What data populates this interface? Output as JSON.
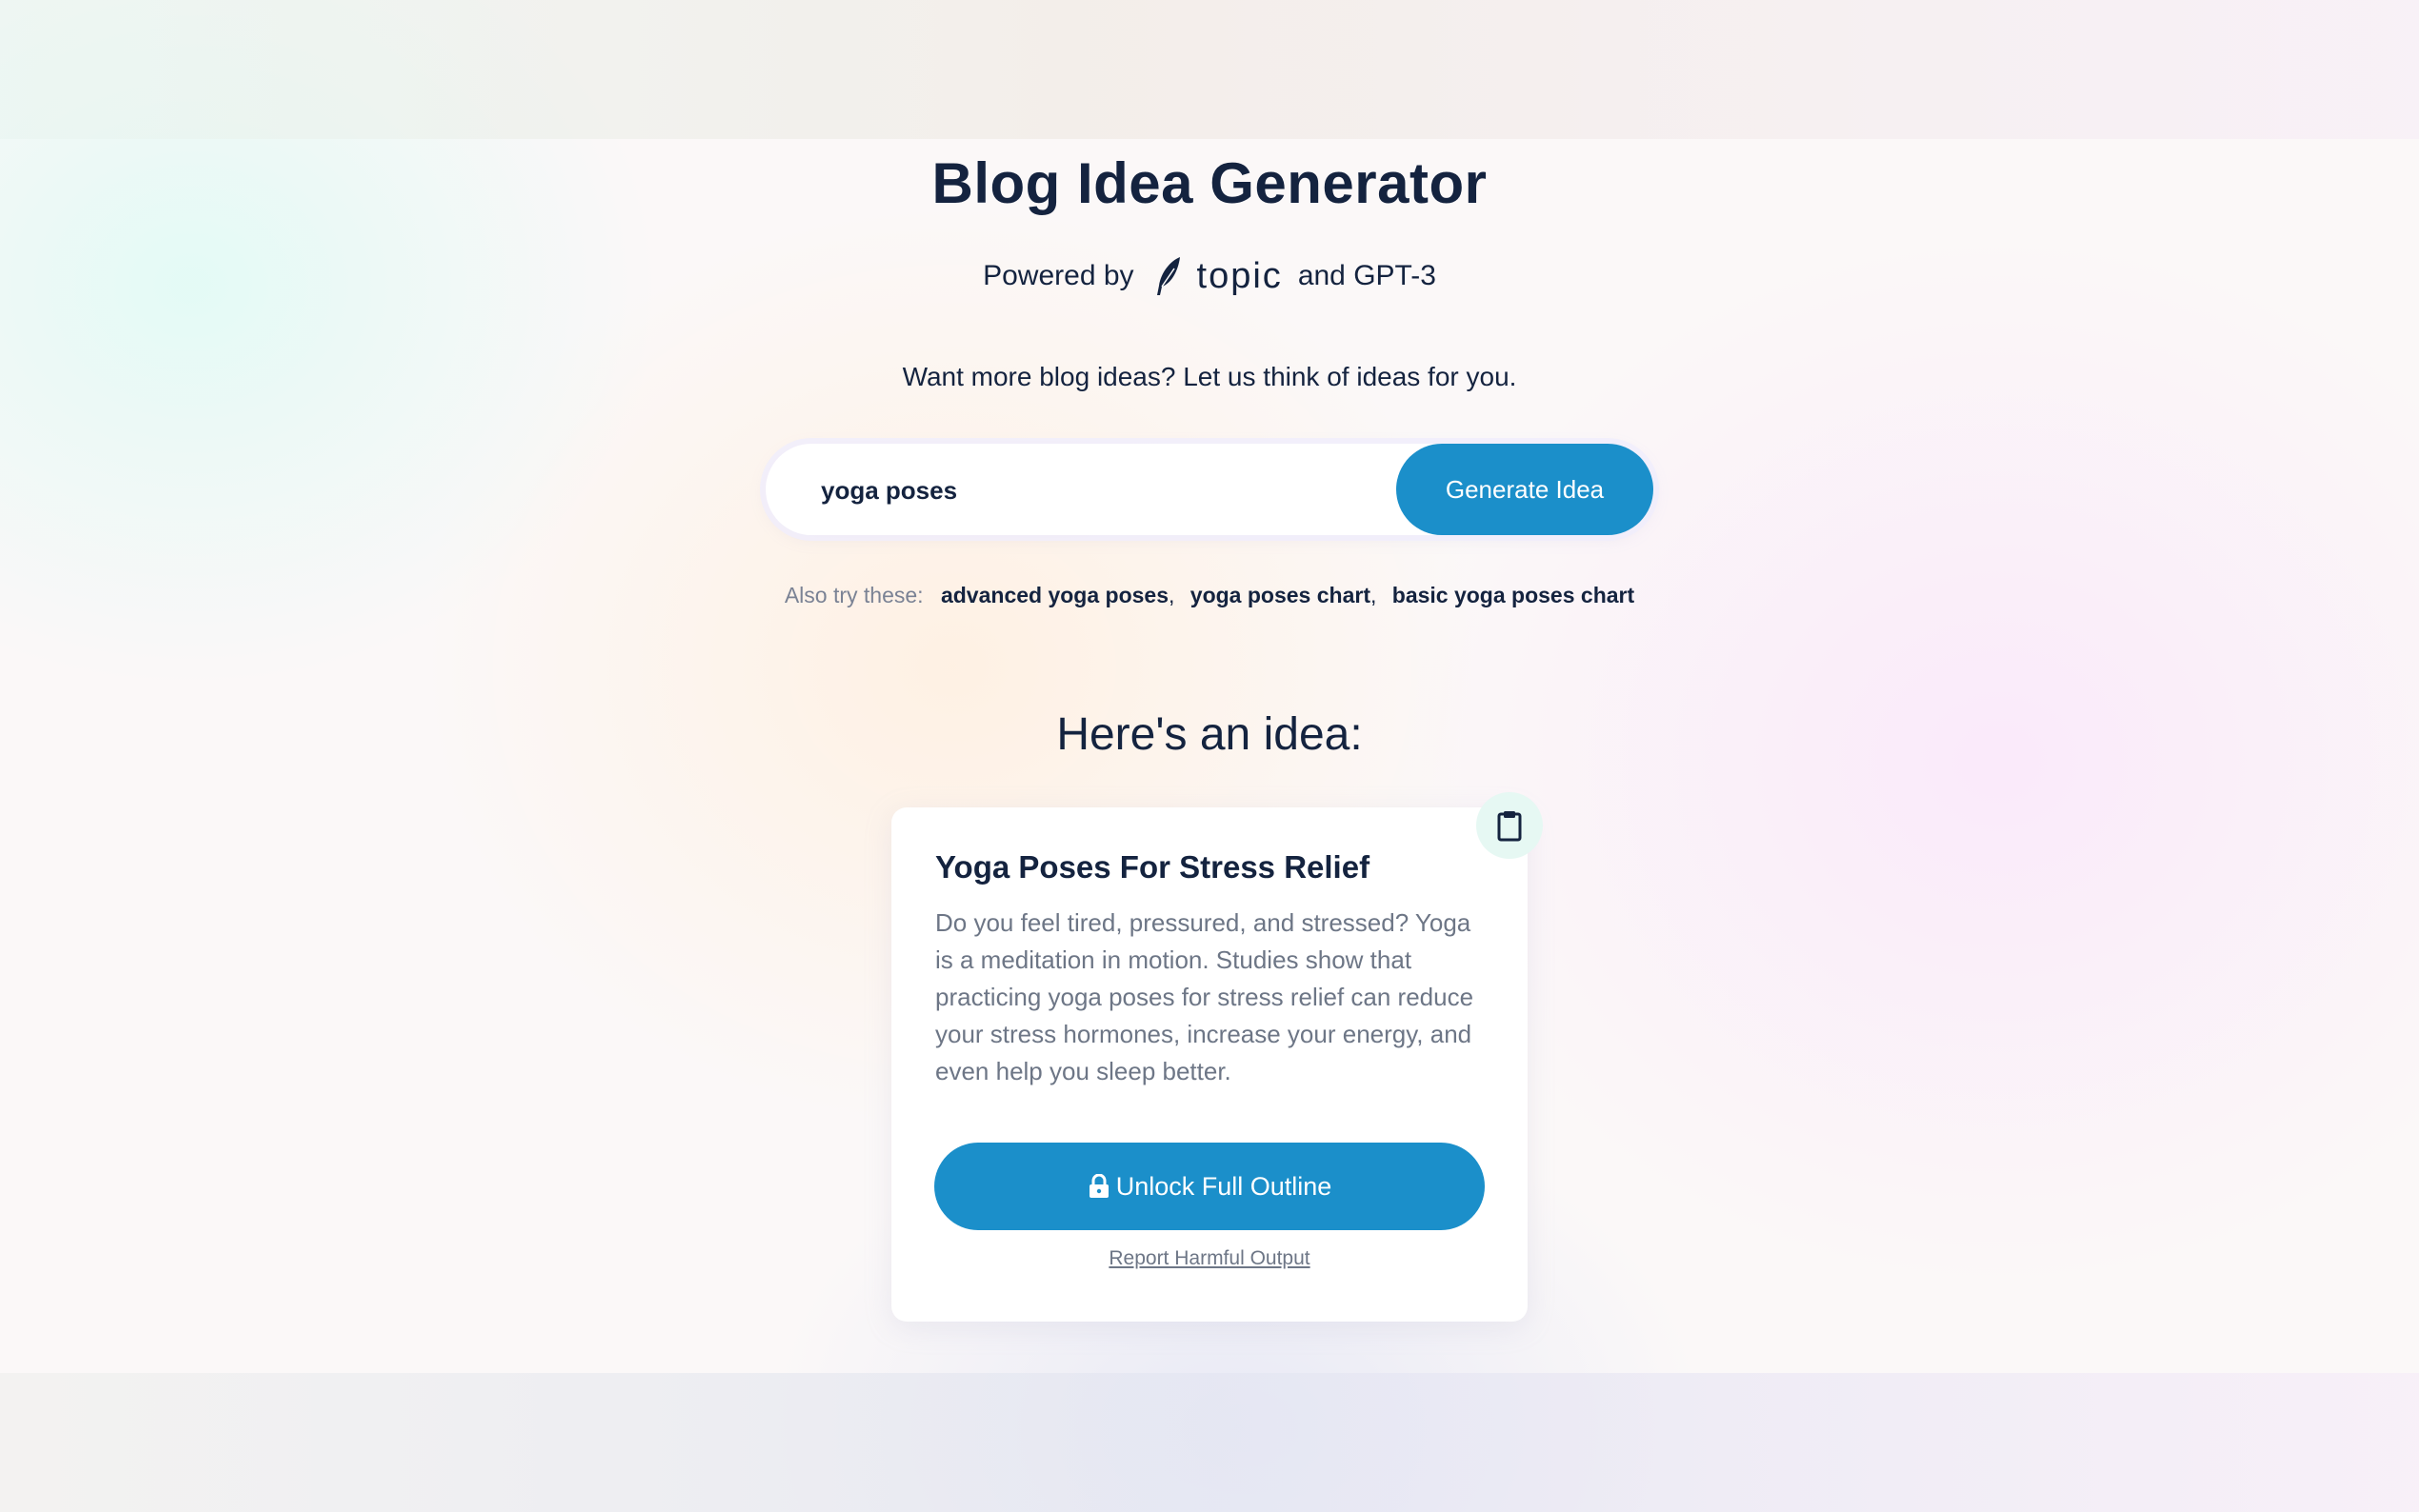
{
  "header": {
    "title": "Blog Idea Generator",
    "powered_prefix": "Powered by",
    "brand": "topic",
    "powered_suffix": "and GPT-3"
  },
  "tagline": "Want more blog ideas? Let us think of ideas for you.",
  "search": {
    "value": "yoga poses",
    "button_label": "Generate Idea"
  },
  "suggestions": {
    "label": "Also try these:",
    "items": [
      "advanced yoga poses",
      "yoga poses chart",
      "basic yoga poses chart"
    ]
  },
  "result": {
    "heading": "Here's an idea:",
    "title": "Yoga Poses For Stress Relief",
    "description": "Do you feel tired, pressured, and stressed? Yoga is a meditation in motion. Studies show that practicing yoga poses for stress relief can reduce your stress hormones, increase your energy, and even help you sleep better.",
    "unlock_label": "Unlock Full Outline",
    "report_label": "Report Harmful Output"
  },
  "icons": {
    "feather": "feather-icon",
    "copy": "clipboard-icon",
    "lock": "lock-icon"
  },
  "colors": {
    "accent": "#1b8fca",
    "text": "#14233f",
    "muted": "#6d7686"
  }
}
